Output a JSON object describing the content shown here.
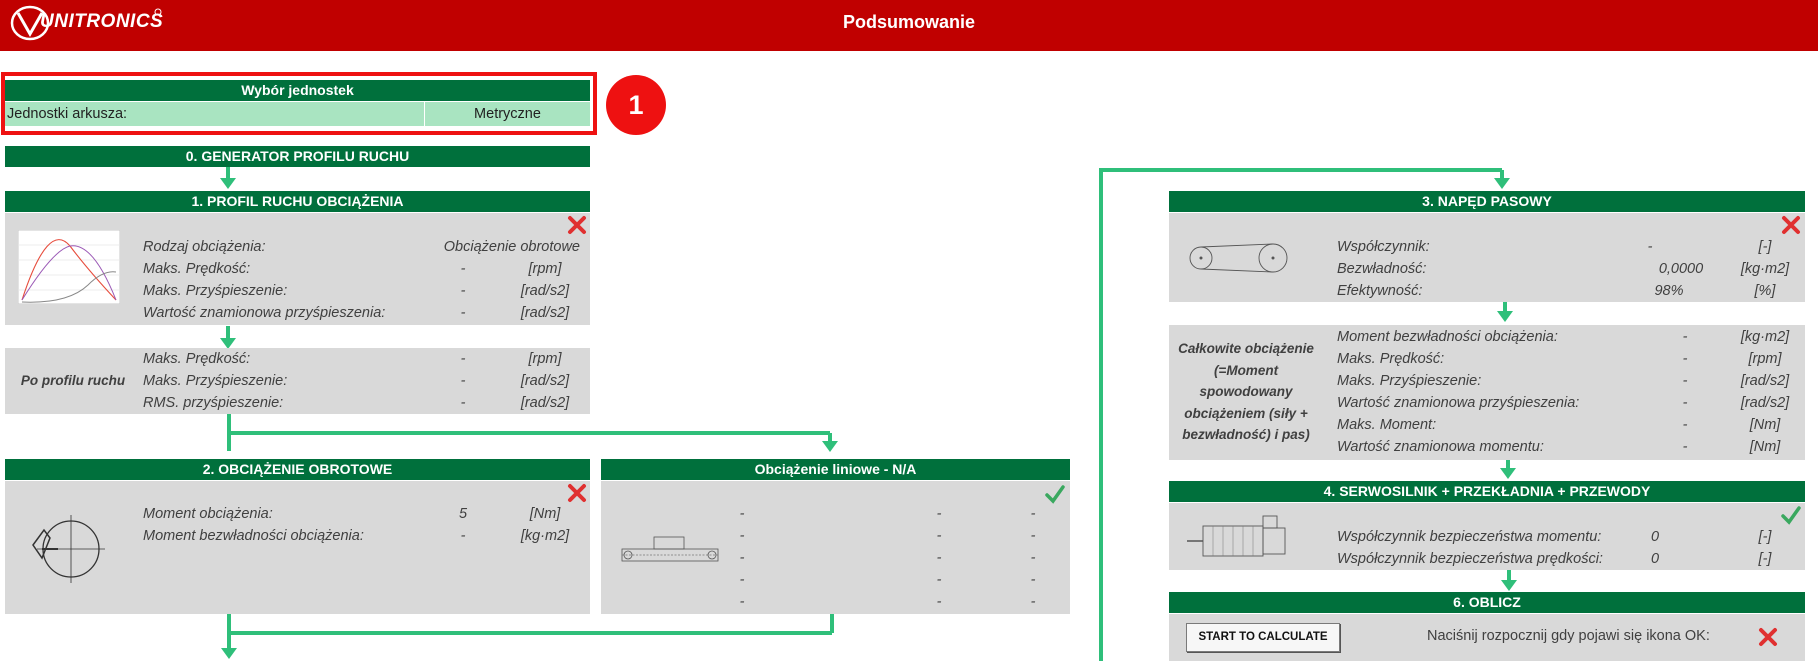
{
  "header": {
    "logo_text": "UNITRONICS",
    "title": "Podsumowanie"
  },
  "colors": {
    "header_red": "#c00000",
    "section_green": "#00703c",
    "units_bg": "#a9e4c1",
    "panel_gray": "#d9d9d9",
    "connector_green": "#2fbf7a",
    "status_x": "#e03030",
    "status_ok": "#3aa85f"
  },
  "units": {
    "title": "Wybór jednostek",
    "label": "Jednostki arkusza:",
    "value": "Metryczne",
    "marker": "1"
  },
  "gen_profile": {
    "title": "0. GENERATOR PROFILU RUCHU"
  },
  "load_profile": {
    "title": "1. PROFIL RUCHU OBCIĄŻENIA",
    "status_icon": "x-icon",
    "rows": [
      {
        "label": "Rodzaj obciążenia:",
        "value": "Obciążenie obrotowe",
        "unit": ""
      },
      {
        "label": "Maks. Prędkość:",
        "value": "-",
        "unit": "[rpm]"
      },
      {
        "label": "Maks. Przyśpieszenie:",
        "value": "-",
        "unit": "[rad/s2]"
      },
      {
        "label": "Wartość znamionowa przyśpieszenia:",
        "value": "-",
        "unit": "[rad/s2]"
      }
    ]
  },
  "after_profile": {
    "side_label": "Po profilu ruchu",
    "rows": [
      {
        "label": "Maks. Prędkość:",
        "value": "-",
        "unit": "[rpm]"
      },
      {
        "label": "Maks. Przyśpieszenie:",
        "value": "-",
        "unit": "[rad/s2]"
      },
      {
        "label": "RMS. przyśpieszenie:",
        "value": "-",
        "unit": "[rad/s2]"
      }
    ]
  },
  "rotary_load": {
    "title": "2. OBCIĄŻENIE OBROTOWE",
    "status_icon": "x-icon",
    "rows": [
      {
        "label": "Moment obciążenia:",
        "value": "5",
        "unit": "[Nm]"
      },
      {
        "label": "Moment bezwładności obciążenia:",
        "value": "-",
        "unit": "[kg·m2]"
      }
    ]
  },
  "linear_load": {
    "title": "Obciążenie liniowe - N/A",
    "status_icon": "check-icon",
    "rows": [
      [
        "-",
        "-",
        "-"
      ],
      [
        "-",
        "-",
        "-"
      ],
      [
        "-",
        "-",
        "-"
      ],
      [
        "-",
        "-",
        "-"
      ],
      [
        "-",
        "-",
        "-"
      ]
    ]
  },
  "belt_drive": {
    "title": "3. NAPĘD PASOWY",
    "status_icon": "x-icon",
    "rows": [
      {
        "label": "Współczynnik:",
        "value": "-",
        "unit": "[-]"
      },
      {
        "label": "Bezwładność:",
        "value": "0,0000",
        "unit": "[kg·m2]"
      },
      {
        "label": "Efektywność:",
        "value": "98%",
        "unit": "[%]"
      }
    ]
  },
  "total_load": {
    "side_label": "Całkowite obciążenie (=Moment spowodowany obciążeniem (siły + bezwładność) i pas)",
    "rows": [
      {
        "label": "Moment bezwładności obciążenia:",
        "value": "-",
        "unit": "[kg·m2]"
      },
      {
        "label": "Maks. Prędkość:",
        "value": "-",
        "unit": "[rpm]"
      },
      {
        "label": "Maks. Przyśpieszenie:",
        "value": "-",
        "unit": "[rad/s2]"
      },
      {
        "label": "Wartość znamionowa przyśpieszenia:",
        "value": "-",
        "unit": "[rad/s2]"
      },
      {
        "label": "Maks. Moment:",
        "value": "-",
        "unit": "[Nm]"
      },
      {
        "label": "Wartość znamionowa momentu:",
        "value": "-",
        "unit": "[Nm]"
      }
    ]
  },
  "servo": {
    "title": "4. SERWOSILNIK + PRZEKŁADNIA + PRZEWODY",
    "status_icon": "check-icon",
    "rows": [
      {
        "label": "Współczynnik bezpieczeństwa momentu:",
        "value": "0",
        "unit": "[-]"
      },
      {
        "label": "Współczynnik bezpieczeństwa prędkości:",
        "value": "0",
        "unit": "[-]"
      }
    ]
  },
  "calculate": {
    "title": "6. OBLICZ",
    "button_label": "START TO CALCULATE",
    "hint": "Naciśnij rozpocznij gdy pojawi się ikona OK:",
    "status_icon": "x-icon"
  }
}
